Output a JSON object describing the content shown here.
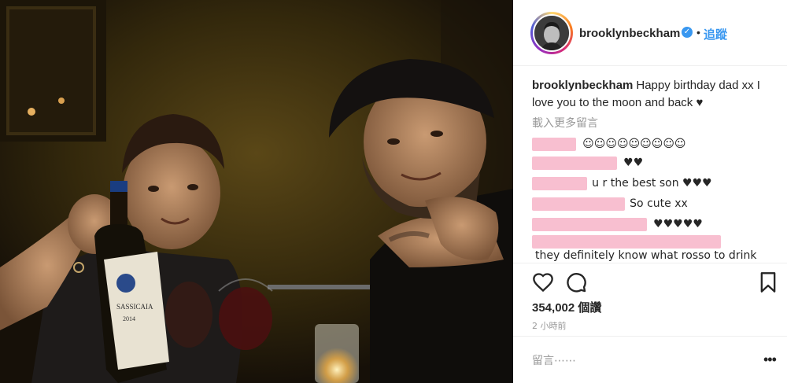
{
  "post": {
    "username": "brooklynbeckham",
    "follow_label": "追蹤",
    "separator": "•",
    "caption_user": "brooklynbeckham",
    "caption_text": "Happy birthday dad xx I love you to the moon and back ♥",
    "load_more_label": "載入更多留言",
    "comments": [
      {
        "text": "☺☺☺☺☺☺☺☺☺"
      },
      {
        "text": "♥♥"
      },
      {
        "text": "u r the best son ♥♥♥"
      },
      {
        "text": "So cute xx"
      },
      {
        "text": "♥♥♥♥♥"
      },
      {
        "text": "they definitely know what rosso to drink ♥ ..."
      }
    ],
    "likes_count": "354,002",
    "likes_label": "個讚",
    "time_ago": "2 小時前",
    "comment_placeholder": "留言⋯⋯",
    "more_label": "•••"
  },
  "photo": {
    "wine_label": "SASSICAIA",
    "wine_year": "2014"
  },
  "colors": {
    "accent": "#3897f0",
    "redaction": "#f8bfd0",
    "muted": "#999999"
  },
  "icons": [
    "heart-icon",
    "comment-icon",
    "bookmark-icon",
    "verified-badge-icon",
    "more-options-icon"
  ]
}
